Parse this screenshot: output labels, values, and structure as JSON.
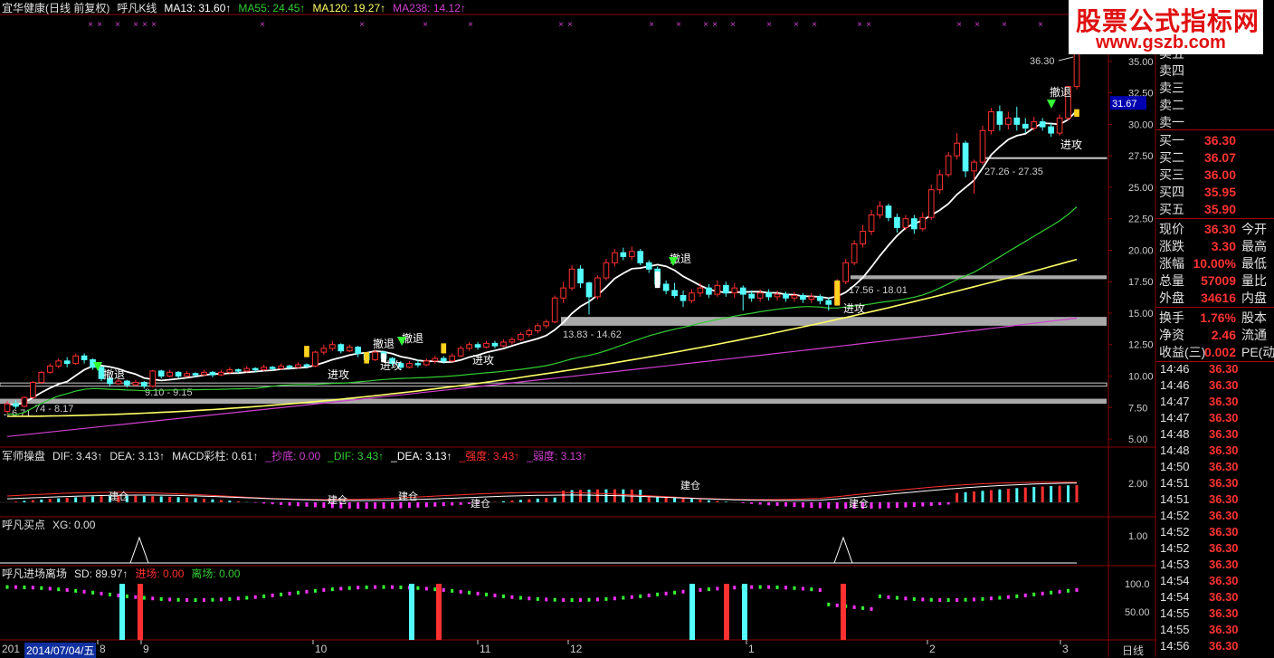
{
  "header": {
    "main": {
      "title": "宜华健康(日线 前复权)",
      "indicator": "呼凡K线",
      "ma13": "MA13: 31.60↑",
      "ma55": "MA55: 24.45↑",
      "ma120": "MA120: 19.27↑",
      "ma238": "MA238: 14.12↑"
    },
    "macd": {
      "name": "军师操盘",
      "dif": "DIF: 3.43↑",
      "dea": "DEA: 3.13↑",
      "bar": "MACD彩柱: 0.61↑",
      "bottom": "_抄底: 0.00",
      "dif2": "_DIF: 3.43↑",
      "dea2": "_DEA: 3.13↑",
      "strong": "_强度: 3.43↑",
      "weak": "_弱度: 3.13↑"
    },
    "buy": {
      "name": "呼凡买点",
      "xg": "XG: 0.00"
    },
    "entry": {
      "name": "呼凡进场离场",
      "sd": "SD: 89.97↑",
      "enter": "进场: 0.00",
      "exit": "离场: 0.00"
    }
  },
  "colors": {
    "up": "#ff3030",
    "down": "#54ffff",
    "ma13": "#ffffff",
    "ma55": "#33cc33",
    "ma120": "#ffff66",
    "ma238": "#d040d0",
    "grid": "#8b0000",
    "band": "#a9a9a9"
  },
  "price_axis": [
    "35.00",
    "32.50",
    "30.00",
    "27.50",
    "25.00",
    "22.50",
    "20.00",
    "17.50",
    "15.00",
    "12.50",
    "10.00",
    "7.50",
    "5.00"
  ],
  "current_price_tag": "31.67",
  "high_label": "36.30",
  "macd_axis": [
    "2.00"
  ],
  "buy_axis": [
    "1.00"
  ],
  "entry_axis": [
    "100.0",
    "50.00"
  ],
  "bands": [
    {
      "label": "6.71",
      "low": 7.8,
      "high": 8.3
    },
    {
      "label": "74 - 8.17",
      "low": 7.8,
      "high": 8.3
    },
    {
      "label": "9.10 - 9.15",
      "low": 9.1,
      "high": 9.15
    },
    {
      "label": "13.83 - 14.62",
      "low": 13.83,
      "high": 14.62
    },
    {
      "label": "17.56 - 18.01",
      "low": 17.56,
      "high": 18.01
    },
    {
      "label": "27.26 - 27.35",
      "low": 27.26,
      "high": 27.35
    }
  ],
  "signals": {
    "retreat": "撤退",
    "attack": "进攻",
    "build": "建仓"
  },
  "quote": {
    "sell": [
      {
        "label": "卖五",
        "value": ""
      },
      {
        "label": "卖四",
        "value": ""
      },
      {
        "label": "卖三",
        "value": ""
      },
      {
        "label": "卖二",
        "value": ""
      },
      {
        "label": "卖一",
        "value": ""
      }
    ],
    "buy": [
      {
        "label": "买一",
        "value": "36.30"
      },
      {
        "label": "买二",
        "value": "36.07"
      },
      {
        "label": "买三",
        "value": "36.00"
      },
      {
        "label": "买四",
        "value": "35.95"
      },
      {
        "label": "买五",
        "value": "35.90"
      }
    ],
    "stats": [
      {
        "label": "现价",
        "value": "36.30",
        "ext": "今开"
      },
      {
        "label": "涨跌",
        "value": "3.30",
        "ext": "最高"
      },
      {
        "label": "涨幅",
        "value": "10.00%",
        "ext": "最低"
      },
      {
        "label": "总量",
        "value": "57009",
        "ext": "量比"
      },
      {
        "label": "外盘",
        "value": "34616",
        "ext": "内盘"
      }
    ],
    "stats2": [
      {
        "label": "换手",
        "value": "1.76%",
        "ext": "股本"
      },
      {
        "label": "净资",
        "value": "2.46",
        "ext": "流通"
      },
      {
        "label": "收益(三)",
        "value": "0.002",
        "ext": "PE(动"
      }
    ],
    "ticks": [
      {
        "time": "14:46",
        "price": "36.30"
      },
      {
        "time": "14:46",
        "price": "36.30"
      },
      {
        "time": "14:47",
        "price": "36.30"
      },
      {
        "time": "14:47",
        "price": "36.30"
      },
      {
        "time": "14:48",
        "price": "36.30"
      },
      {
        "time": "14:48",
        "price": "36.30"
      },
      {
        "time": "14:50",
        "price": "36.30"
      },
      {
        "time": "14:51",
        "price": "36.30"
      },
      {
        "time": "14:51",
        "price": "36.30"
      },
      {
        "time": "14:52",
        "price": "36.30"
      },
      {
        "time": "14:52",
        "price": "36.30"
      },
      {
        "time": "14:52",
        "price": "36.30"
      },
      {
        "time": "14:53",
        "price": "36.30"
      },
      {
        "time": "14:54",
        "price": "36.30"
      },
      {
        "time": "14:54",
        "price": "36.30"
      },
      {
        "time": "14:55",
        "price": "36.30"
      },
      {
        "time": "14:55",
        "price": "36.30"
      },
      {
        "time": "14:56",
        "price": "36.30"
      }
    ]
  },
  "watermark": {
    "line1": "股票公式指标网",
    "line2": "www.gszb.com"
  },
  "date_axis": {
    "start": "201",
    "cursor": "2014/07/04/五",
    "months": [
      "8",
      "9",
      "10",
      "11",
      "12",
      "1",
      "2",
      "3"
    ],
    "period": "日线"
  },
  "chart_data": {
    "type": "candlestick",
    "price_range": [
      4.5,
      37
    ],
    "candles": [
      [
        7.2,
        7.8,
        7.0,
        8.0
      ],
      [
        7.8,
        7.6,
        7.4,
        8.1
      ],
      [
        7.6,
        8.3,
        7.5,
        8.4
      ],
      [
        8.3,
        9.5,
        8.2,
        9.6
      ],
      [
        9.5,
        10.3,
        9.4,
        10.4
      ],
      [
        10.3,
        10.8,
        10.2,
        11.0
      ],
      [
        10.8,
        11.2,
        10.6,
        11.4
      ],
      [
        11.2,
        11.0,
        10.7,
        11.5
      ],
      [
        11.0,
        11.6,
        10.9,
        11.8
      ],
      [
        11.6,
        11.3,
        11.0,
        11.8
      ],
      [
        11.3,
        10.7,
        10.5,
        11.4
      ],
      [
        10.7,
        9.8,
        9.6,
        10.8
      ],
      [
        9.8,
        9.4,
        9.2,
        10.0
      ],
      [
        9.4,
        9.6,
        9.3,
        9.8
      ],
      [
        9.6,
        9.3,
        9.1,
        9.7
      ],
      [
        9.3,
        9.5,
        9.2,
        9.7
      ],
      [
        9.5,
        9.2,
        9.0,
        9.6
      ],
      [
        9.2,
        10.4,
        9.1,
        10.5
      ],
      [
        10.4,
        10.0,
        9.8,
        10.5
      ],
      [
        10.0,
        10.3,
        9.9,
        10.5
      ],
      [
        10.3,
        10.0,
        9.8,
        10.4
      ],
      [
        10.0,
        10.2,
        9.9,
        10.4
      ],
      [
        10.2,
        10.1,
        9.9,
        10.3
      ],
      [
        10.1,
        10.3,
        10.0,
        10.5
      ],
      [
        10.3,
        10.1,
        9.9,
        10.4
      ],
      [
        10.1,
        10.3,
        10.0,
        10.5
      ],
      [
        10.3,
        10.5,
        10.2,
        10.7
      ],
      [
        10.5,
        10.4,
        10.2,
        10.6
      ],
      [
        10.4,
        10.6,
        10.3,
        10.8
      ],
      [
        10.6,
        10.5,
        10.3,
        10.7
      ],
      [
        10.5,
        10.7,
        10.4,
        10.9
      ],
      [
        10.7,
        10.6,
        10.4,
        10.8
      ],
      [
        10.6,
        10.8,
        10.5,
        11.0
      ],
      [
        10.8,
        10.7,
        10.5,
        10.9
      ],
      [
        10.7,
        10.9,
        10.6,
        11.1
      ],
      [
        10.9,
        10.8,
        10.6,
        11.0
      ],
      [
        10.8,
        11.9,
        10.7,
        12.0
      ],
      [
        11.9,
        12.2,
        11.7,
        12.5
      ],
      [
        12.2,
        12.5,
        12.0,
        12.8
      ],
      [
        12.5,
        12.0,
        11.8,
        12.6
      ],
      [
        12.0,
        12.3,
        11.9,
        12.5
      ],
      [
        12.3,
        11.8,
        11.5,
        12.4
      ],
      [
        11.8,
        11.3,
        11.0,
        11.9
      ],
      [
        11.3,
        11.9,
        11.2,
        12.1
      ],
      [
        11.9,
        11.4,
        11.2,
        12.0
      ],
      [
        11.4,
        11.0,
        10.8,
        11.5
      ],
      [
        11.0,
        10.7,
        10.5,
        11.2
      ],
      [
        10.7,
        11.0,
        10.6,
        11.2
      ],
      [
        11.0,
        10.9,
        10.7,
        11.3
      ],
      [
        10.9,
        11.2,
        10.8,
        11.4
      ],
      [
        11.2,
        11.4,
        11.0,
        11.6
      ],
      [
        11.4,
        11.2,
        11.0,
        11.6
      ],
      [
        11.2,
        11.6,
        11.1,
        11.8
      ],
      [
        11.6,
        12.2,
        11.5,
        12.4
      ],
      [
        12.2,
        12.5,
        12.0,
        12.7
      ],
      [
        12.5,
        12.3,
        12.1,
        12.7
      ],
      [
        12.3,
        12.6,
        12.2,
        12.8
      ],
      [
        12.6,
        12.4,
        12.2,
        12.8
      ],
      [
        12.4,
        12.7,
        12.3,
        12.9
      ],
      [
        12.7,
        12.9,
        12.5,
        13.1
      ],
      [
        12.9,
        13.3,
        12.8,
        13.5
      ],
      [
        13.3,
        13.6,
        13.1,
        13.8
      ],
      [
        13.6,
        14.0,
        13.4,
        14.2
      ],
      [
        14.0,
        14.3,
        13.8,
        14.5
      ],
      [
        14.3,
        16.2,
        14.2,
        16.4
      ],
      [
        16.2,
        17.0,
        15.8,
        17.5
      ],
      [
        17.0,
        18.5,
        16.8,
        18.8
      ],
      [
        18.5,
        17.4,
        17.0,
        18.8
      ],
      [
        17.4,
        16.3,
        14.9,
        17.5
      ],
      [
        16.3,
        17.8,
        16.1,
        18.0
      ],
      [
        17.8,
        19.0,
        17.6,
        19.3
      ],
      [
        19.0,
        19.8,
        18.7,
        20.1
      ],
      [
        19.8,
        19.5,
        19.2,
        20.2
      ],
      [
        19.5,
        19.9,
        19.2,
        20.3
      ],
      [
        19.9,
        19.0,
        18.8,
        20.1
      ],
      [
        19.0,
        18.5,
        18.2,
        19.2
      ],
      [
        18.5,
        17.3,
        17.0,
        18.7
      ],
      [
        17.3,
        16.8,
        16.5,
        17.6
      ],
      [
        16.8,
        16.4,
        16.2,
        17.4
      ],
      [
        16.4,
        16.0,
        15.5,
        16.8
      ],
      [
        16.0,
        16.6,
        15.8,
        16.9
      ],
      [
        16.6,
        17.0,
        16.3,
        17.4
      ],
      [
        17.0,
        16.5,
        16.2,
        17.3
      ],
      [
        16.5,
        17.2,
        16.3,
        17.6
      ],
      [
        17.2,
        16.6,
        16.3,
        17.5
      ],
      [
        16.6,
        17.0,
        16.2,
        17.4
      ],
      [
        17.0,
        16.5,
        15.2,
        17.2
      ],
      [
        16.5,
        16.2,
        15.9,
        16.8
      ],
      [
        16.2,
        16.6,
        15.9,
        16.9
      ],
      [
        16.6,
        16.3,
        16.0,
        16.9
      ],
      [
        16.3,
        16.5,
        16.0,
        16.8
      ],
      [
        16.5,
        16.2,
        15.9,
        16.7
      ],
      [
        16.2,
        16.4,
        15.9,
        16.7
      ],
      [
        16.4,
        16.1,
        15.8,
        16.6
      ],
      [
        16.1,
        16.3,
        15.8,
        16.6
      ],
      [
        16.3,
        16.0,
        15.7,
        16.5
      ],
      [
        16.0,
        15.7,
        15.2,
        16.2
      ],
      [
        15.7,
        17.5,
        15.6,
        17.7
      ],
      [
        17.5,
        19.0,
        17.3,
        19.3
      ],
      [
        19.0,
        20.5,
        18.8,
        20.8
      ],
      [
        20.5,
        21.5,
        20.2,
        22.0
      ],
      [
        21.5,
        22.8,
        21.2,
        23.2
      ],
      [
        22.8,
        23.5,
        22.5,
        23.9
      ],
      [
        23.5,
        22.6,
        22.3,
        23.7
      ],
      [
        22.6,
        21.8,
        21.4,
        22.9
      ],
      [
        21.8,
        22.5,
        21.6,
        22.8
      ],
      [
        22.5,
        21.7,
        21.3,
        22.8
      ],
      [
        21.7,
        22.6,
        21.5,
        23.0
      ],
      [
        22.6,
        24.8,
        22.4,
        25.2
      ],
      [
        24.8,
        26.0,
        24.5,
        26.4
      ],
      [
        26.0,
        27.5,
        25.8,
        27.8
      ],
      [
        27.5,
        28.5,
        27.2,
        29.3
      ],
      [
        28.5,
        26.3,
        25.8,
        28.7
      ],
      [
        26.3,
        27.0,
        24.5,
        27.2
      ],
      [
        27.0,
        29.5,
        26.8,
        29.9
      ],
      [
        29.5,
        31.0,
        29.2,
        31.3
      ],
      [
        31.0,
        30.0,
        29.5,
        31.5
      ],
      [
        30.0,
        30.5,
        29.6,
        31.0
      ],
      [
        30.5,
        30.0,
        29.5,
        31.4
      ],
      [
        30.0,
        29.7,
        29.3,
        30.5
      ],
      [
        29.7,
        30.2,
        29.5,
        30.6
      ],
      [
        30.2,
        29.8,
        29.5,
        30.5
      ],
      [
        29.8,
        29.3,
        29.0,
        30.1
      ],
      [
        29.3,
        30.5,
        29.1,
        30.8
      ],
      [
        30.5,
        33.0,
        30.3,
        33.0
      ],
      [
        33.0,
        36.3,
        32.8,
        36.3
      ]
    ]
  }
}
